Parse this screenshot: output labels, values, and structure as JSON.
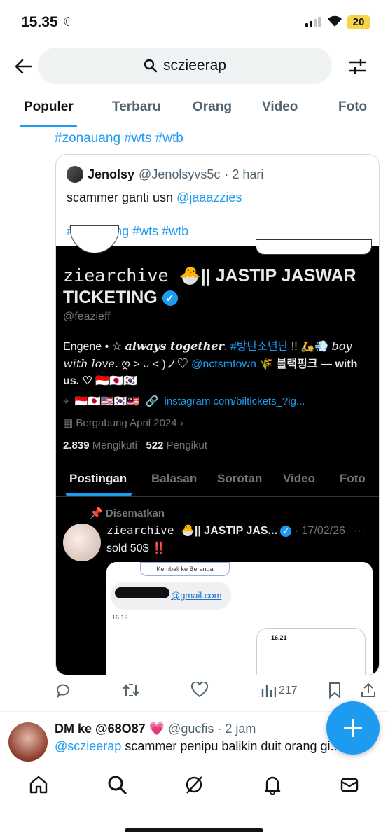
{
  "status_bar": {
    "time": "15.35",
    "battery": "20"
  },
  "search": {
    "query": "sczieerap"
  },
  "tabs": [
    "Populer",
    "Terbaru",
    "Orang",
    "Video",
    "Foto"
  ],
  "tweet1": {
    "tags": "#zonauang #wts #wtb",
    "quote": {
      "name": "Jenolsy",
      "handle": "@Jenolsyvs5c",
      "time": "· 2 hari",
      "text_prefix": "scammer ganti usn ",
      "mention": "@jaaazzies",
      "tags": "#zonauang #wts #wtb",
      "screenshot": {
        "display_name_mono": "ziearchive 🐣",
        "display_name_rest": "|| JASTIP JASWAR TICKETING",
        "handle": "@feazieff",
        "bio_1": "Engene • ☆ ",
        "bio_bold_italic": "always together",
        "bio_2": ", ",
        "bio_tag": "#방탄소년단",
        "bio_3": " !! 🛵💨 ",
        "bio_italic": "boy with love.",
        "bio_4": " ღ ˃ ᴗ ˂ )ノ♡ ",
        "bio_mention": "@nctsmtown",
        "bio_5": " 🌾 블랙핑크 — with us. ♡ 🇮🇩🇯🇵🇰🇷",
        "location_flags": "🇮🇩🇯🇵🇺🇸🇰🇷🇲🇾",
        "link": "instagram.com/biltickets_?ig...",
        "joined": "Bergabung April 2024",
        "following_count": "2.839",
        "following_label": "Mengikuti",
        "followers_count": "522",
        "followers_label": "Pengikut",
        "profile_tabs": [
          "Postingan",
          "Balasan",
          "Sorotan",
          "Video",
          "Foto"
        ],
        "pinned_label": "Disematkan",
        "inner_name_mono": "ziearchive 🐣",
        "inner_name_rest": "|| JASTIP JAS...",
        "inner_date": "· 17/02/26",
        "inner_text": "sold 50$ ‼️",
        "inner_shot_bar": "Kembali ke Beranda",
        "inner_shot_mail": "@gmail.com",
        "inner_shot_time1": "16.19",
        "inner_shot_time2": "16.21"
      }
    },
    "views": "217"
  },
  "tweet2": {
    "name": "DM ke @68O87 💗",
    "handle": "@gucfis",
    "time": "· 2 jam",
    "mention": "@sczieerap",
    "text": " scammer penipu balikin duit orang gi..."
  },
  "colors": {
    "accent": "#1d9bf0",
    "text": "#0f1419",
    "muted": "#536471"
  }
}
